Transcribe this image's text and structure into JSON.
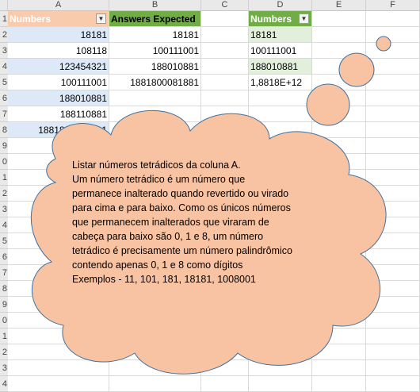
{
  "column_headers": [
    "A",
    "B",
    "C",
    "D",
    "E",
    "F"
  ],
  "row_numbers": [
    "1",
    "2",
    "3",
    "4",
    "5",
    "6",
    "7",
    "8",
    "9",
    "0",
    "1",
    "2",
    "3",
    "4",
    "5",
    "6",
    "7",
    "8",
    "9",
    "0",
    "1",
    "2",
    "3",
    "4"
  ],
  "table_a": {
    "header": "Numbers",
    "values": [
      "18181",
      "108118",
      "123454321",
      "100111001",
      "188010881",
      "188110881",
      "1881800081881"
    ]
  },
  "table_b": {
    "header": "Answers Expected",
    "values": [
      "18181",
      "100111001",
      "188010881",
      "1881800081881"
    ]
  },
  "table_d": {
    "header": "Numbers",
    "values": [
      "18181",
      "100111001",
      "188010881",
      "1,8818E+12"
    ]
  },
  "filter_icon": "dropdown-arrow",
  "cloud": {
    "lines": [
      "Listar números tetrádicos da coluna A.",
      "Um número tetrádico é um número que",
      "permanece inalterado quando revertido ou virado",
      "para cima e para baixo. Como os únicos números",
      "que permanecem inalterados que viraram de",
      "cabeça para baixo são 0, 1 e 8, um número",
      "tetrádico é precisamente um número palindrômico",
      "contendo apenas 0, 1 e 8 como dígitos",
      "Exemplos - 11, 101, 181, 18181, 1008001"
    ]
  },
  "colors": {
    "header_a": "#f8cbad",
    "header_b": "#70ad47",
    "row_blue": "#dde9f7",
    "row_green": "#e2efda",
    "cloud_fill": "#f8c3a2",
    "cloud_border": "#41719c"
  }
}
